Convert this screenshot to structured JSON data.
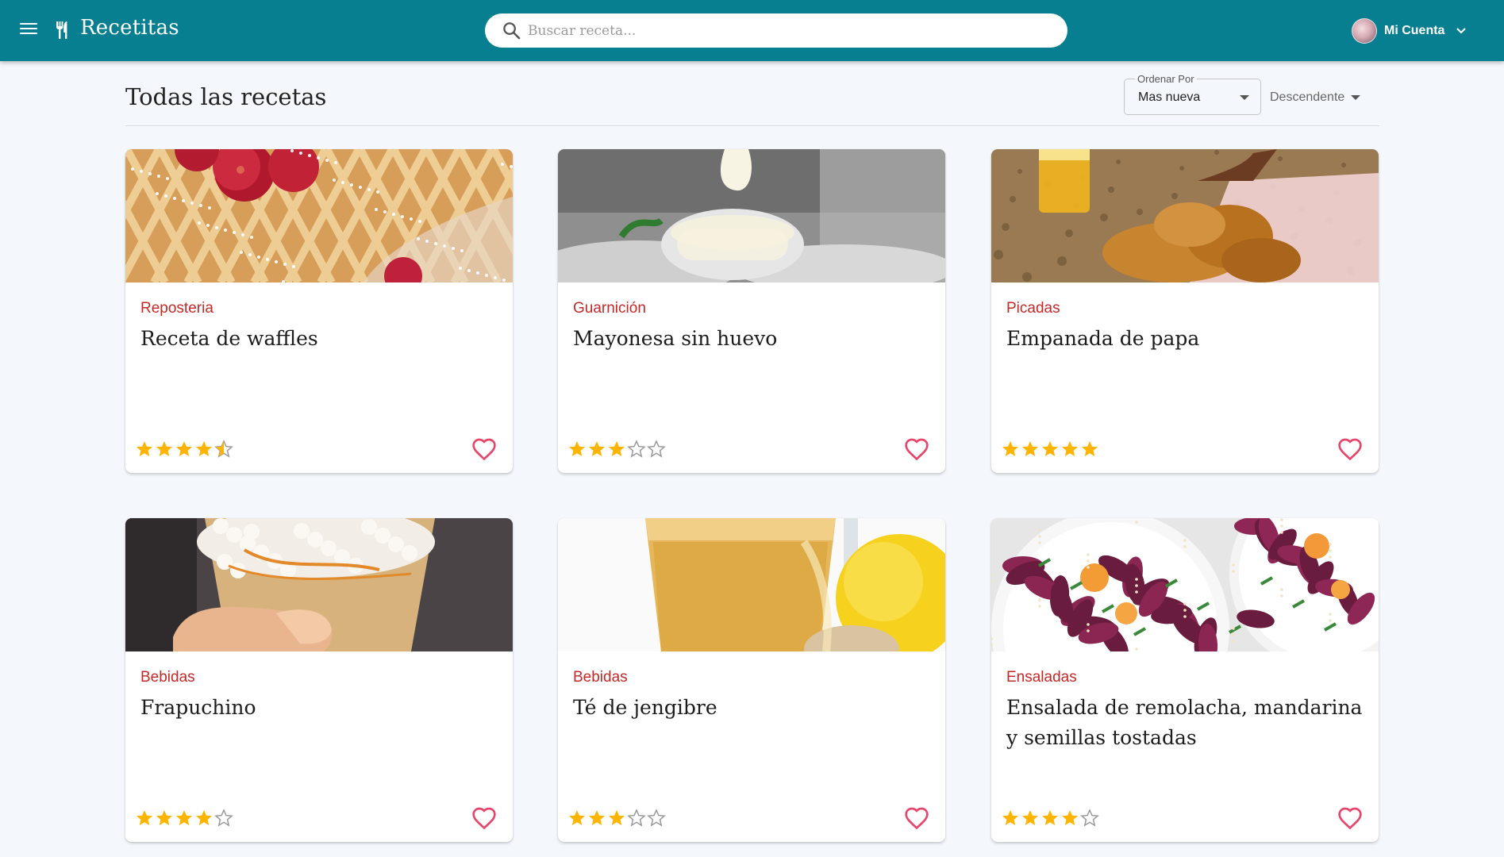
{
  "app": {
    "title": "Recetitas"
  },
  "search": {
    "placeholder": "Buscar receta..."
  },
  "account": {
    "label": "Mi Cuenta"
  },
  "page": {
    "title": "Todas las recetas"
  },
  "sort": {
    "legend": "Ordenar Por",
    "value": "Mas nueva",
    "order": "Descendente"
  },
  "colors": {
    "appbar": "#087f90",
    "category": "#c62828",
    "star": "#ffb400",
    "heart": "#e8456b"
  },
  "recipes": [
    {
      "category": "Reposteria",
      "title": "Receta de waffles",
      "rating": 4.5,
      "image": "waffles-photo"
    },
    {
      "category": "Guarnición",
      "title": "Mayonesa sin huevo",
      "rating": 3,
      "image": "mayonnaise-photo"
    },
    {
      "category": "Picadas",
      "title": "Empanada de papa",
      "rating": 5,
      "image": "empanadas-photo"
    },
    {
      "category": "Bebidas",
      "title": "Frapuchino",
      "rating": 4,
      "image": "frappuccino-photo"
    },
    {
      "category": "Bebidas",
      "title": "Té de jengibre",
      "rating": 3,
      "image": "ginger-tea-photo"
    },
    {
      "category": "Ensaladas",
      "title": "Ensalada de remolacha, mandarina y semillas tostadas",
      "rating": 4,
      "image": "beet-salad-photo"
    }
  ]
}
